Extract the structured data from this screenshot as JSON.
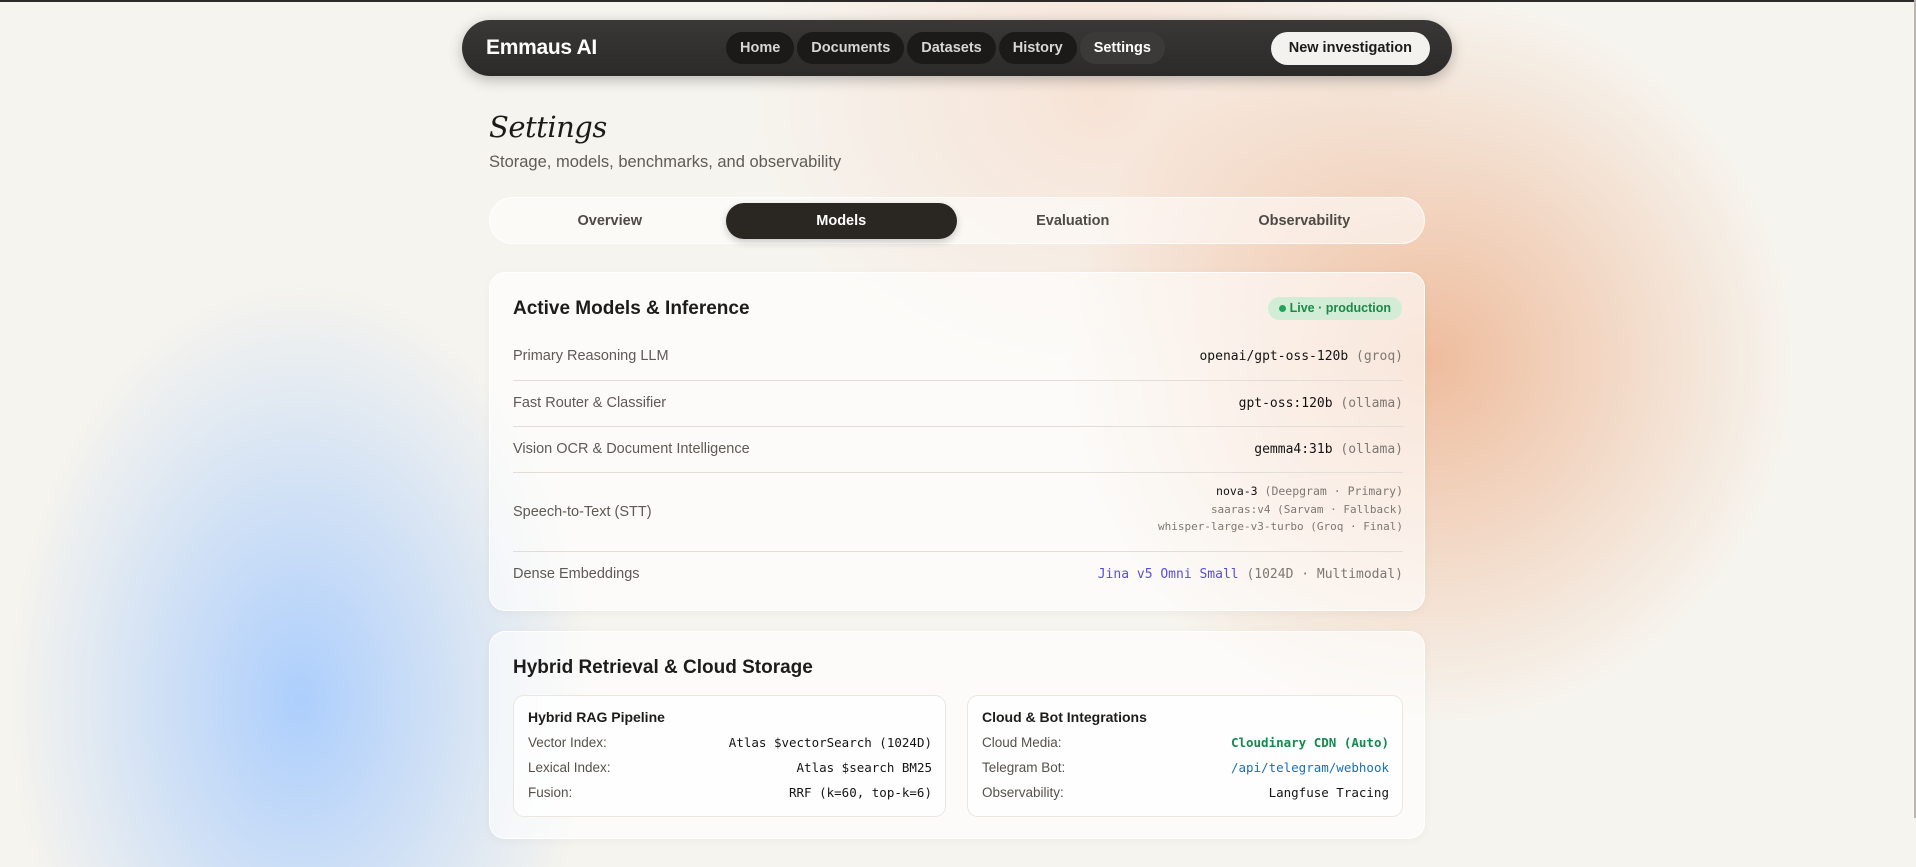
{
  "app": {
    "brand": "Emmaus AI",
    "nav": [
      "Home",
      "Documents",
      "Datasets",
      "History",
      "Settings"
    ],
    "nav_active": "Settings",
    "new_button": "New investigation"
  },
  "header": {
    "title": "Settings",
    "subtitle": "Storage, models, benchmarks, and observability"
  },
  "tabs": [
    "Overview",
    "Models",
    "Evaluation",
    "Observability"
  ],
  "tabs_active": "Models",
  "models_card": {
    "title": "Active Models & Inference",
    "badge": "Live · production",
    "rows": [
      {
        "label": "Primary Reasoning LLM",
        "value": "openai/gpt-oss-120b",
        "meta": " (groq)"
      },
      {
        "label": "Fast Router & Classifier",
        "value": "gpt-oss:120b",
        "meta": " (ollama)"
      },
      {
        "label": "Vision OCR & Document Intelligence",
        "value": "gemma4:31b",
        "meta": " (ollama)"
      },
      {
        "label": "Speech-to-Text (STT)",
        "stt": [
          {
            "value": "nova-3",
            "meta": " (Deepgram · Primary)"
          },
          {
            "value": "saaras:v4",
            "meta": " (Sarvam · Fallback)"
          },
          {
            "value": "whisper-large-v3-turbo",
            "meta": " (Groq · Final)"
          }
        ]
      },
      {
        "label": "Dense Embeddings",
        "value": "Jina v5 Omni Small",
        "meta": " (1024D · Multimodal)"
      }
    ]
  },
  "retrieval_card": {
    "title": "Hybrid Retrieval & Cloud Storage",
    "left": {
      "title": "Hybrid RAG Pipeline",
      "items": [
        {
          "key": "Vector Index:",
          "value": "Atlas $vectorSearch (1024D)"
        },
        {
          "key": "Lexical Index:",
          "value": "Atlas $search BM25"
        },
        {
          "key": "Fusion:",
          "value": "RRF (k=60, top-k=6)"
        }
      ]
    },
    "right": {
      "title": "Cloud & Bot Integrations",
      "items": [
        {
          "key": "Cloud Media:",
          "value": "Cloudinary CDN (Auto)"
        },
        {
          "key": "Telegram Bot:",
          "value": "/api/telegram/webhook"
        },
        {
          "key": "Observability:",
          "value": "Langfuse Tracing"
        }
      ]
    }
  },
  "colors": {
    "accent_dark": "#2a2622",
    "live_green": "#1fa55a",
    "link_purple": "#5850d6",
    "link_blue": "#1a6fb8"
  }
}
